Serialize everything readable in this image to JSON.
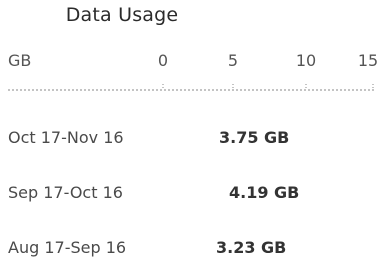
{
  "title": "Data Usage",
  "axis": {
    "unit": "GB",
    "ticks": [
      "0",
      "5",
      "10",
      "15"
    ]
  },
  "rows": [
    {
      "period": "Oct 17-Nov 16",
      "usage": "3.75 GB",
      "usage_gb": 3.75
    },
    {
      "period": "Sep 17-Oct 16",
      "usage": "4.19 GB",
      "usage_gb": 4.19
    },
    {
      "period": "Aug 17-Sep 16",
      "usage": "3.23 GB",
      "usage_gb": 3.23
    }
  ]
}
